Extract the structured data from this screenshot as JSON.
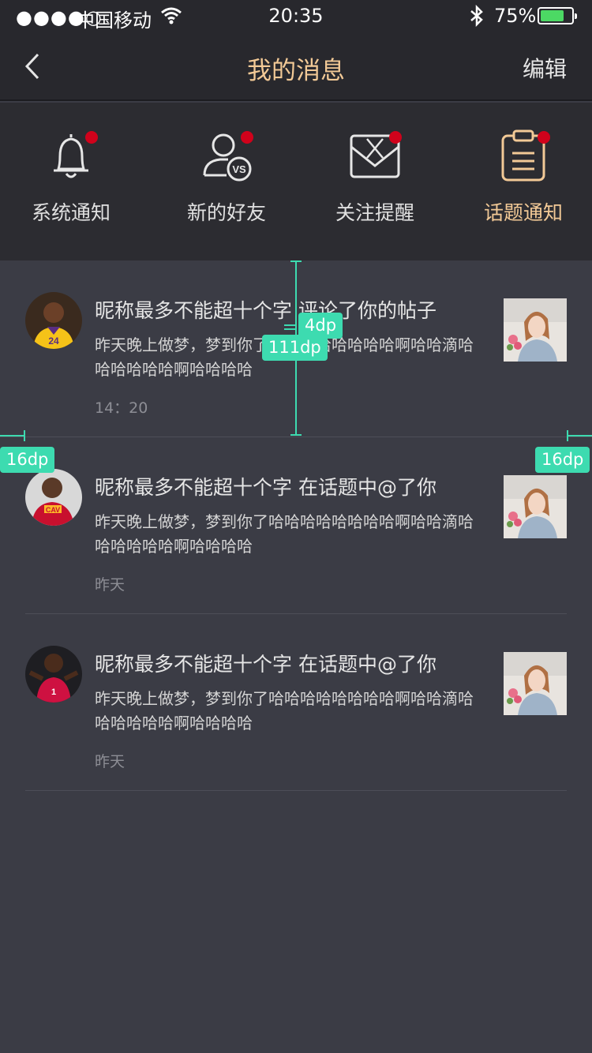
{
  "status_bar": {
    "signal": "●●●●○",
    "carrier": "中国移动",
    "time": "20:35",
    "battery": "75%",
    "battery_level": 0.75
  },
  "nav": {
    "title": "我的消息",
    "edit_label": "编辑"
  },
  "categories": [
    {
      "label": "系统通知",
      "icon": "bell-icon",
      "active": false
    },
    {
      "label": "新的好友",
      "icon": "friend-vs-icon",
      "active": false
    },
    {
      "label": "关注提醒",
      "icon": "envelope-icon",
      "active": false
    },
    {
      "label": "话题通知",
      "icon": "clipboard-icon",
      "active": true
    }
  ],
  "messages": [
    {
      "title": "昵称最多不能超十个字 评论了你的帖子",
      "body": "昨天晚上做梦，梦到你了哈哈哈哈哈哈哈哈啊哈哈滴哈哈哈哈哈哈啊哈哈哈哈",
      "time": "14：20"
    },
    {
      "title": "昵称最多不能超十个字 在话题中@了你",
      "body": "昨天晚上做梦，梦到你了哈哈哈哈哈哈哈哈啊哈哈滴哈哈哈哈哈哈啊哈哈哈哈",
      "time": "昨天"
    },
    {
      "title": "昵称最多不能超十个字 在话题中@了你",
      "body": "昨天晚上做梦，梦到你了哈哈哈哈哈哈哈哈啊哈哈滴哈哈哈哈哈哈啊哈哈哈哈",
      "time": "昨天"
    }
  ],
  "annotations": {
    "gap_small": "4dp",
    "row_height": "111dp",
    "margin_left": "16dp",
    "margin_right": "16dp"
  },
  "colors": {
    "accent": "#f2c996",
    "badge": "#d0021b",
    "annotation": "#3ddbb0",
    "background": "#3b3c45"
  }
}
